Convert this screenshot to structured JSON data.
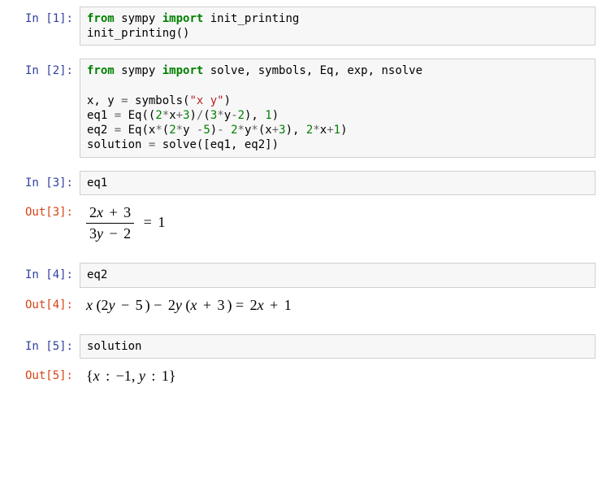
{
  "cells": {
    "in1": {
      "prompt": "In [1]:",
      "tokens": {
        "t0": "from",
        "t1": " sympy ",
        "t2": "import",
        "t3": " init_printing\ninit_printing()"
      }
    },
    "in2": {
      "prompt": "In [2]:",
      "tokens": {
        "t0": "from",
        "t1": " sympy ",
        "t2": "import",
        "t3": " solve, symbols, Eq, exp, nsolve\n\nx, y ",
        "t4": "=",
        "t5": " symbols(",
        "t6": "\"x y\"",
        "t7": ")\neq1 ",
        "t8": "=",
        "t9": " Eq((",
        "t10": "2",
        "t11": "*",
        "t12": "x",
        "t13": "+",
        "t14": "3",
        "t15": ")",
        "t16": "/",
        "t17": "(",
        "t18": "3",
        "t19": "*",
        "t20": "y",
        "t21": "-",
        "t22": "2",
        "t23": "), ",
        "t24": "1",
        "t25": ")\neq2 ",
        "t26": "=",
        "t27": " Eq(x",
        "t28": "*",
        "t29": "(",
        "t30": "2",
        "t31": "*",
        "t32": "y ",
        "t33": "-",
        "t34": "5",
        "t35": ")",
        "t36": "-",
        "t37": " ",
        "t38": "2",
        "t39": "*",
        "t40": "y",
        "t41": "*",
        "t42": "(x",
        "t43": "+",
        "t44": "3",
        "t45": "), ",
        "t46": "2",
        "t47": "*",
        "t48": "x",
        "t49": "+",
        "t50": "1",
        "t51": ")\nsolution ",
        "t52": "=",
        "t53": " solve([eq1, eq2])"
      }
    },
    "in3": {
      "prompt": "In [3]:",
      "code": "eq1"
    },
    "out3": {
      "prompt": "Out[3]:",
      "frac_num_a": "2",
      "frac_num_b": "x",
      "frac_num_c": " + ",
      "frac_num_d": "3",
      "frac_den_a": "3",
      "frac_den_b": "y",
      "frac_den_c": " − ",
      "frac_den_d": "2",
      "eq": " = ",
      "rhs": "1"
    },
    "in4": {
      "prompt": "In [4]:",
      "code": "eq2"
    },
    "out4": {
      "prompt": "Out[4]:",
      "p0": "x",
      "p1": " (",
      "p2": "2",
      "p3": "y",
      "p4": " − ",
      "p5": "5",
      "p6": ") − ",
      "p7": "2",
      "p8": "y",
      "p9": " (",
      "p10": "x",
      "p11": " + ",
      "p12": "3",
      "p13": ") = ",
      "p14": "2",
      "p15": "x",
      "p16": " + ",
      "p17": "1"
    },
    "in5": {
      "prompt": "In [5]:",
      "code": "solution"
    },
    "out5": {
      "prompt": "Out[5]:",
      "p0": "{",
      "p1": "x",
      "p2": " : ",
      "p3": "−1",
      "p4": ",  ",
      "p5": "y",
      "p6": " : ",
      "p7": "1",
      "p8": "}"
    }
  }
}
